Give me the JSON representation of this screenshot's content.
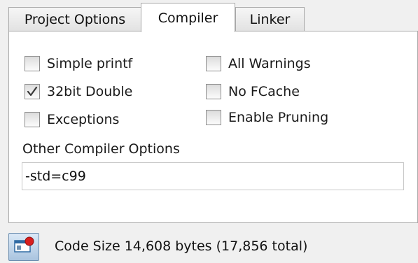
{
  "tabs": [
    {
      "label": "Project Options",
      "active": false
    },
    {
      "label": "Compiler",
      "active": true
    },
    {
      "label": "Linker",
      "active": false
    }
  ],
  "options": {
    "simple_printf": {
      "label": "Simple printf",
      "checked": false
    },
    "double_32bit": {
      "label": "32bit Double",
      "checked": true
    },
    "exceptions": {
      "label": "Exceptions",
      "checked": false
    },
    "all_warnings": {
      "label": "All Warnings",
      "checked": false
    },
    "no_fcache": {
      "label": "No FCache",
      "checked": false
    },
    "enable_pruning": {
      "label": "Enable Pruning",
      "checked": false
    }
  },
  "other_options": {
    "label": "Other Compiler Options",
    "value": "-std=c99"
  },
  "status": {
    "text": "Code Size 14,608 bytes (17,856 total)",
    "icon": "window-record-icon"
  },
  "colors": {
    "checkmark": "#3a3a3a",
    "icon_red": "#d81e1e",
    "icon_blue": "#2f6aa3"
  }
}
